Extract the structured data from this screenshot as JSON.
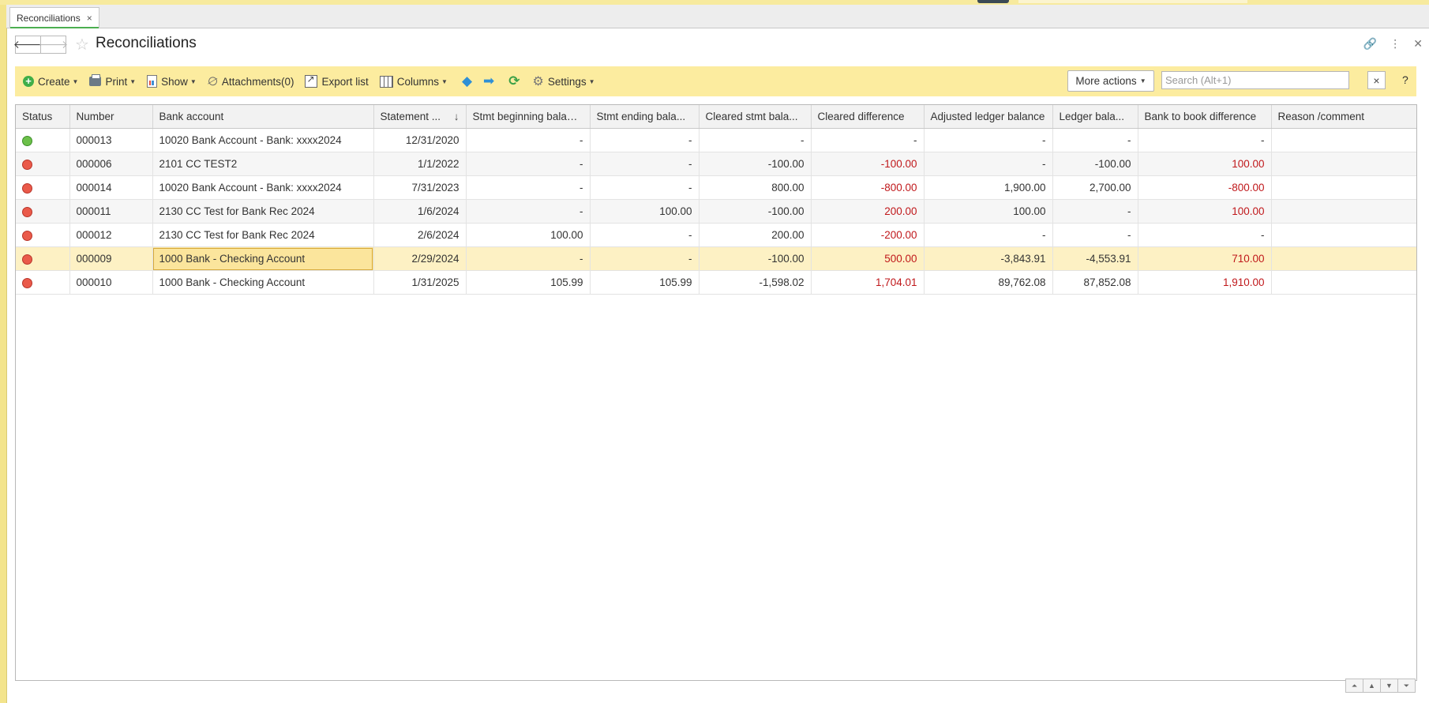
{
  "tab": {
    "label": "Reconciliations",
    "close": "×"
  },
  "header": {
    "title": "Reconciliations",
    "back": "🡐",
    "forward": "🡒"
  },
  "toolbar": {
    "create": "Create",
    "print": "Print",
    "show": "Show",
    "attachments": "Attachments(0)",
    "export_list": "Export list",
    "columns": "Columns",
    "settings": "Settings",
    "more_actions": "More actions",
    "help": "?"
  },
  "search": {
    "placeholder": "Search (Alt+1)",
    "clear": "×"
  },
  "columns": [
    "Status",
    "Number",
    "Bank account",
    "Statement ...",
    "Stmt beginning balance",
    "Stmt ending bala...",
    "Cleared stmt bala...",
    "Cleared difference",
    "Adjusted ledger balance",
    "Ledger bala...",
    "Bank to book difference",
    "Reason /comment"
  ],
  "sort_indicator": "↓",
  "rows": [
    {
      "status": "green",
      "number": "000013",
      "bank": "10020 Bank Account - Bank: xxxx2024",
      "date": "12/31/2020",
      "beg": "-",
      "end": "-",
      "cleared": "-",
      "cleared_diff": "-",
      "adj_ledger": "-",
      "ledger": "-",
      "b2b": "-",
      "reason": ""
    },
    {
      "status": "red",
      "number": "000006",
      "bank": "2101 CC TEST2",
      "date": "1/1/2022",
      "beg": "-",
      "end": "-",
      "cleared": "-100.00",
      "cleared_diff": "-100.00",
      "adj_ledger": "-",
      "ledger": "-100.00",
      "b2b": "100.00",
      "reason": ""
    },
    {
      "status": "red",
      "number": "000014",
      "bank": "10020 Bank Account - Bank: xxxx2024",
      "date": "7/31/2023",
      "beg": "-",
      "end": "-",
      "cleared": "800.00",
      "cleared_diff": "-800.00",
      "adj_ledger": "1,900.00",
      "ledger": "2,700.00",
      "b2b": "-800.00",
      "reason": ""
    },
    {
      "status": "red",
      "number": "000011",
      "bank": "2130 CC Test for Bank Rec 2024",
      "date": "1/6/2024",
      "beg": "-",
      "end": "100.00",
      "cleared": "-100.00",
      "cleared_diff": "200.00",
      "adj_ledger": "100.00",
      "ledger": "-",
      "b2b": "100.00",
      "reason": ""
    },
    {
      "status": "red",
      "number": "000012",
      "bank": "2130 CC Test for Bank Rec 2024",
      "date": "2/6/2024",
      "beg": "100.00",
      "end": "-",
      "cleared": "200.00",
      "cleared_diff": "-200.00",
      "adj_ledger": "-",
      "ledger": "-",
      "b2b": "-",
      "reason": ""
    },
    {
      "status": "red",
      "number": "000009",
      "bank": "1000 Bank - Checking Account",
      "date": "2/29/2024",
      "beg": "-",
      "end": "-",
      "cleared": "-100.00",
      "cleared_diff": "500.00",
      "adj_ledger": "-3,843.91",
      "ledger": "-4,553.91",
      "b2b": "710.00",
      "reason": ""
    },
    {
      "status": "red",
      "number": "000010",
      "bank": "1000 Bank - Checking Account",
      "date": "1/31/2025",
      "beg": "105.99",
      "end": "105.99",
      "cleared": "-1,598.02",
      "cleared_diff": "1,704.01",
      "adj_ledger": "89,762.08",
      "ledger": "87,852.08",
      "b2b": "1,910.00",
      "reason": ""
    }
  ],
  "colors": {
    "accent_yellow": "#fcec9f",
    "negative_red": "#c0181b",
    "status_green": "#6cc04a",
    "status_red": "#ea5a4a"
  }
}
